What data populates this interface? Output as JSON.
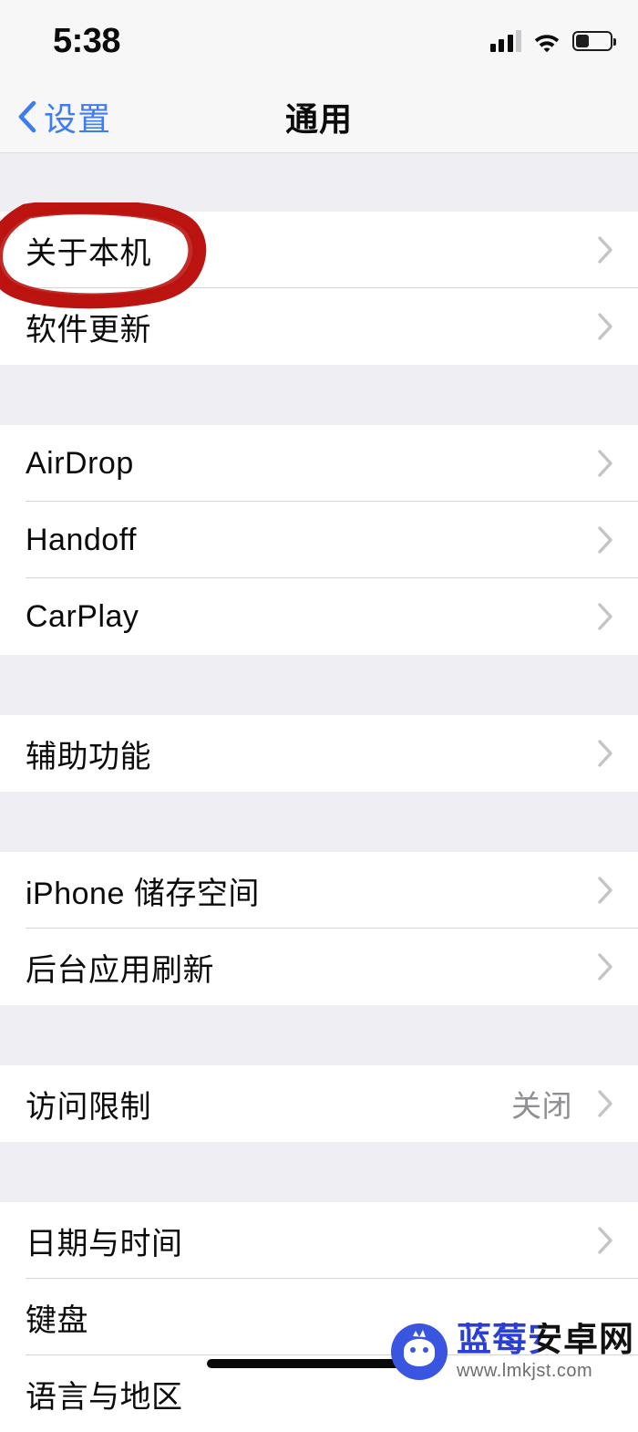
{
  "status_bar": {
    "time": "5:38",
    "signal_icon": "cellular-signal-icon",
    "signal_bars_filled": 3,
    "signal_bars_total": 4,
    "wifi_icon": "wifi-icon",
    "battery_icon": "battery-icon",
    "battery_level_percent": 36
  },
  "nav_bar": {
    "back_label": "设置",
    "back_icon": "chevron-left-icon",
    "title": "通用",
    "back_color": "#3f7cf2"
  },
  "annotation": {
    "type": "hand-drawn-ellipse",
    "color": "#bb1411",
    "target_label": "关于本机"
  },
  "sections": [
    {
      "rows": [
        {
          "label": "关于本机",
          "value": "",
          "accessory": "chevron-right-icon",
          "highlighted": true
        },
        {
          "label": "软件更新",
          "value": "",
          "accessory": "chevron-right-icon",
          "highlighted": false
        }
      ]
    },
    {
      "rows": [
        {
          "label": "AirDrop",
          "value": "",
          "accessory": "chevron-right-icon",
          "highlighted": false
        },
        {
          "label": "Handoff",
          "value": "",
          "accessory": "chevron-right-icon",
          "highlighted": false
        },
        {
          "label": "CarPlay",
          "value": "",
          "accessory": "chevron-right-icon",
          "highlighted": false
        }
      ]
    },
    {
      "rows": [
        {
          "label": "辅助功能",
          "value": "",
          "accessory": "chevron-right-icon",
          "highlighted": false
        }
      ]
    },
    {
      "rows": [
        {
          "label": "iPhone 储存空间",
          "value": "",
          "accessory": "chevron-right-icon",
          "highlighted": false
        },
        {
          "label": "后台应用刷新",
          "value": "",
          "accessory": "chevron-right-icon",
          "highlighted": false
        }
      ]
    },
    {
      "rows": [
        {
          "label": "访问限制",
          "value": "关闭",
          "accessory": "chevron-right-icon",
          "highlighted": false
        }
      ]
    },
    {
      "rows": [
        {
          "label": "日期与时间",
          "value": "",
          "accessory": "chevron-right-icon",
          "highlighted": false
        },
        {
          "label": "键盘",
          "value": "",
          "accessory": "",
          "highlighted": false
        },
        {
          "label": "语言与地区",
          "value": "",
          "accessory": "",
          "highlighted": false
        }
      ]
    }
  ],
  "watermark": {
    "title": "蓝莓安卓网",
    "url": "www.lmkjst.com",
    "logo_icon": "android-robot-logo-icon"
  },
  "home_indicator": "home-indicator-bar"
}
